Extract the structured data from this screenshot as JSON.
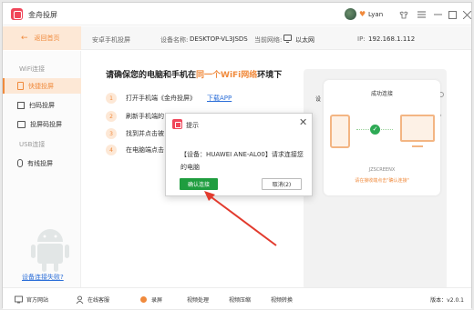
{
  "app": {
    "title": "金舟投屏",
    "user_name": "Lyan",
    "vip_icon": "heart-vip-icon"
  },
  "window_controls": {
    "skin_icon": "shirt-icon",
    "menu_icon": "menu-icon",
    "minimize_icon": "minimize-icon",
    "maximize_icon": "maximize-icon",
    "close_icon": "close-icon"
  },
  "subheader": {
    "back_label": "返回首页",
    "mode_label": "安卓手机投屏",
    "device_label": "设备名称:",
    "device_value": "DESKTOP-VL3JSDS",
    "network_label": "当前网络:",
    "network_value": "以太网",
    "ip_label": "IP:",
    "ip_value": "192.168.1.112"
  },
  "sidebar": {
    "wifi_section": "WiFi连接",
    "items": [
      {
        "label": "快捷投屏",
        "active": true
      },
      {
        "label": "扫码投屏",
        "active": false
      },
      {
        "label": "投屏码投屏",
        "active": false
      }
    ],
    "usb_section": "USB连接",
    "usb_items": [
      {
        "label": "有线投屏",
        "active": false
      }
    ],
    "help_link": "设备连接失败?"
  },
  "main": {
    "headline_pre": "请确保您的电脑和手机在",
    "headline_hl": "同一个WiFi网络",
    "headline_post": "环境下",
    "steps": [
      {
        "num": "1",
        "text": "打开手机端《金舟投屏》",
        "link": "下载APP"
      },
      {
        "num": "2",
        "text": "刷新手机端的"
      },
      {
        "num": "3",
        "text": "找到并点击被"
      },
      {
        "num": "4",
        "text": "在电脑端点击"
      }
    ]
  },
  "preview": {
    "title": "成功连接",
    "brand": "JZSCREENX",
    "hint": "请在接收端点击\"确认连接\"",
    "side_text": "设"
  },
  "dialog": {
    "title": "提示",
    "message": "【设备：HUAWEI ANE-AL00】请求连接您的电脑",
    "confirm_label": "确认连接",
    "cancel_label": "取消(2)"
  },
  "footer": {
    "items": [
      {
        "label": "官方网站",
        "icon": "website-icon"
      },
      {
        "label": "在线客服",
        "icon": "support-icon"
      },
      {
        "label": "录屏",
        "icon": "record-icon"
      },
      {
        "label": "视频处理",
        "icon": ""
      },
      {
        "label": "视频压缩",
        "icon": ""
      },
      {
        "label": "视频转换",
        "icon": ""
      }
    ],
    "version": "版本：v2.0.1"
  },
  "colors": {
    "accent": "#f08a3c",
    "accent_light": "#fde8d6",
    "logo": "#f0465a",
    "confirm": "#1f9d3f",
    "link": "#2b6ed8",
    "arrow": "#e23b2e"
  }
}
